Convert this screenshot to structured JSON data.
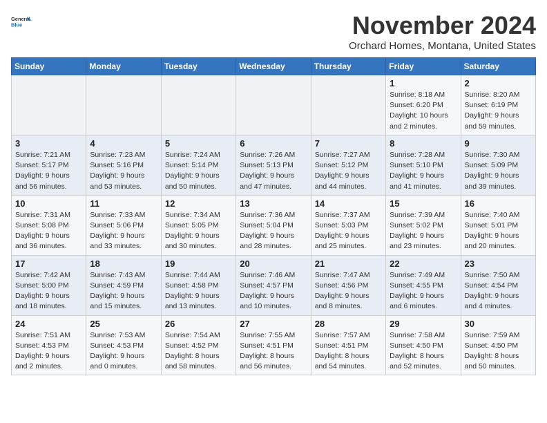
{
  "header": {
    "logo_line1": "General",
    "logo_line2": "Blue",
    "month": "November 2024",
    "location": "Orchard Homes, Montana, United States"
  },
  "weekdays": [
    "Sunday",
    "Monday",
    "Tuesday",
    "Wednesday",
    "Thursday",
    "Friday",
    "Saturday"
  ],
  "weeks": [
    [
      {
        "day": "",
        "info": ""
      },
      {
        "day": "",
        "info": ""
      },
      {
        "day": "",
        "info": ""
      },
      {
        "day": "",
        "info": ""
      },
      {
        "day": "",
        "info": ""
      },
      {
        "day": "1",
        "info": "Sunrise: 8:18 AM\nSunset: 6:20 PM\nDaylight: 10 hours and 2 minutes."
      },
      {
        "day": "2",
        "info": "Sunrise: 8:20 AM\nSunset: 6:19 PM\nDaylight: 9 hours and 59 minutes."
      }
    ],
    [
      {
        "day": "3",
        "info": "Sunrise: 7:21 AM\nSunset: 5:17 PM\nDaylight: 9 hours and 56 minutes."
      },
      {
        "day": "4",
        "info": "Sunrise: 7:23 AM\nSunset: 5:16 PM\nDaylight: 9 hours and 53 minutes."
      },
      {
        "day": "5",
        "info": "Sunrise: 7:24 AM\nSunset: 5:14 PM\nDaylight: 9 hours and 50 minutes."
      },
      {
        "day": "6",
        "info": "Sunrise: 7:26 AM\nSunset: 5:13 PM\nDaylight: 9 hours and 47 minutes."
      },
      {
        "day": "7",
        "info": "Sunrise: 7:27 AM\nSunset: 5:12 PM\nDaylight: 9 hours and 44 minutes."
      },
      {
        "day": "8",
        "info": "Sunrise: 7:28 AM\nSunset: 5:10 PM\nDaylight: 9 hours and 41 minutes."
      },
      {
        "day": "9",
        "info": "Sunrise: 7:30 AM\nSunset: 5:09 PM\nDaylight: 9 hours and 39 minutes."
      }
    ],
    [
      {
        "day": "10",
        "info": "Sunrise: 7:31 AM\nSunset: 5:08 PM\nDaylight: 9 hours and 36 minutes."
      },
      {
        "day": "11",
        "info": "Sunrise: 7:33 AM\nSunset: 5:06 PM\nDaylight: 9 hours and 33 minutes."
      },
      {
        "day": "12",
        "info": "Sunrise: 7:34 AM\nSunset: 5:05 PM\nDaylight: 9 hours and 30 minutes."
      },
      {
        "day": "13",
        "info": "Sunrise: 7:36 AM\nSunset: 5:04 PM\nDaylight: 9 hours and 28 minutes."
      },
      {
        "day": "14",
        "info": "Sunrise: 7:37 AM\nSunset: 5:03 PM\nDaylight: 9 hours and 25 minutes."
      },
      {
        "day": "15",
        "info": "Sunrise: 7:39 AM\nSunset: 5:02 PM\nDaylight: 9 hours and 23 minutes."
      },
      {
        "day": "16",
        "info": "Sunrise: 7:40 AM\nSunset: 5:01 PM\nDaylight: 9 hours and 20 minutes."
      }
    ],
    [
      {
        "day": "17",
        "info": "Sunrise: 7:42 AM\nSunset: 5:00 PM\nDaylight: 9 hours and 18 minutes."
      },
      {
        "day": "18",
        "info": "Sunrise: 7:43 AM\nSunset: 4:59 PM\nDaylight: 9 hours and 15 minutes."
      },
      {
        "day": "19",
        "info": "Sunrise: 7:44 AM\nSunset: 4:58 PM\nDaylight: 9 hours and 13 minutes."
      },
      {
        "day": "20",
        "info": "Sunrise: 7:46 AM\nSunset: 4:57 PM\nDaylight: 9 hours and 10 minutes."
      },
      {
        "day": "21",
        "info": "Sunrise: 7:47 AM\nSunset: 4:56 PM\nDaylight: 9 hours and 8 minutes."
      },
      {
        "day": "22",
        "info": "Sunrise: 7:49 AM\nSunset: 4:55 PM\nDaylight: 9 hours and 6 minutes."
      },
      {
        "day": "23",
        "info": "Sunrise: 7:50 AM\nSunset: 4:54 PM\nDaylight: 9 hours and 4 minutes."
      }
    ],
    [
      {
        "day": "24",
        "info": "Sunrise: 7:51 AM\nSunset: 4:53 PM\nDaylight: 9 hours and 2 minutes."
      },
      {
        "day": "25",
        "info": "Sunrise: 7:53 AM\nSunset: 4:53 PM\nDaylight: 9 hours and 0 minutes."
      },
      {
        "day": "26",
        "info": "Sunrise: 7:54 AM\nSunset: 4:52 PM\nDaylight: 8 hours and 58 minutes."
      },
      {
        "day": "27",
        "info": "Sunrise: 7:55 AM\nSunset: 4:51 PM\nDaylight: 8 hours and 56 minutes."
      },
      {
        "day": "28",
        "info": "Sunrise: 7:57 AM\nSunset: 4:51 PM\nDaylight: 8 hours and 54 minutes."
      },
      {
        "day": "29",
        "info": "Sunrise: 7:58 AM\nSunset: 4:50 PM\nDaylight: 8 hours and 52 minutes."
      },
      {
        "day": "30",
        "info": "Sunrise: 7:59 AM\nSunset: 4:50 PM\nDaylight: 8 hours and 50 minutes."
      }
    ]
  ]
}
